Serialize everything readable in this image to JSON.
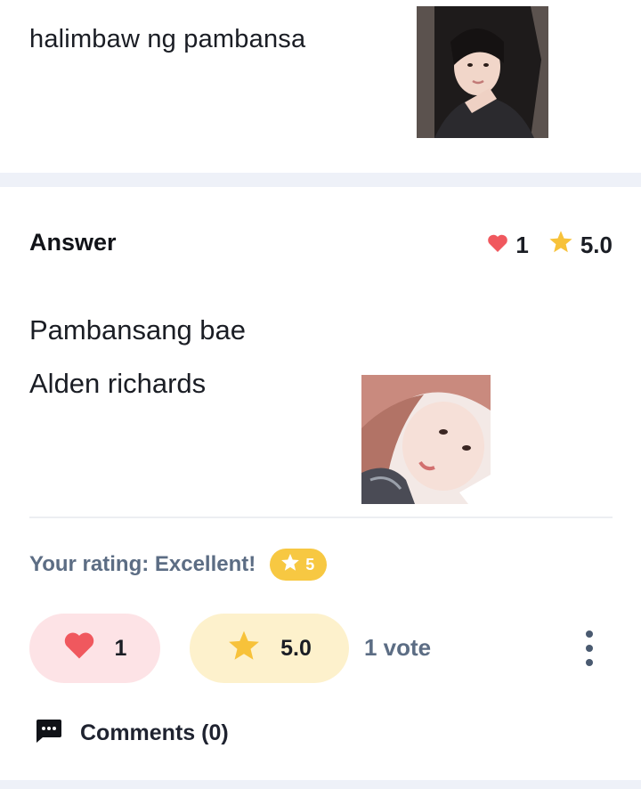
{
  "question": {
    "text": "halimbaw ng pambansa",
    "photo_description_icon": "question-photo"
  },
  "answer": {
    "heading": "Answer",
    "likes": "1",
    "rating": "5.0",
    "lines": [
      "Pambansang bae",
      "Alden richards"
    ],
    "photo_icon": "answer-photo"
  },
  "your_rating": {
    "label": "Your rating: Excellent!",
    "stars": "5"
  },
  "actions": {
    "like_count": "1",
    "rating_value": "5.0",
    "votes": "1 vote"
  },
  "comments": {
    "label": "Comments (0)"
  },
  "colors": {
    "heart": "#f0585e",
    "star": "#f7c23a",
    "badge": "#f7c842",
    "muted": "#5c6d84",
    "like_pill": "#fde3e6",
    "rate_pill": "#fdf1cc",
    "divider": "#eef1f8"
  }
}
